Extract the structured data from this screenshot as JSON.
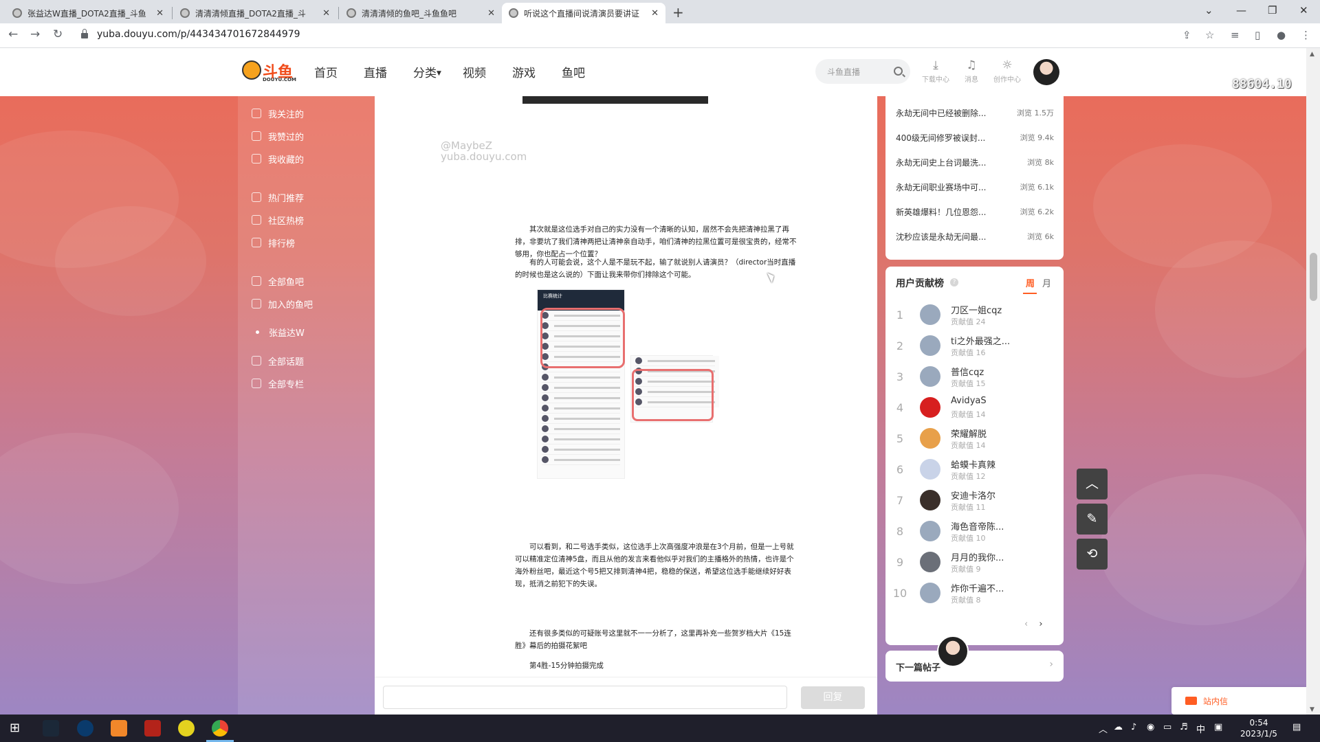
{
  "browser": {
    "tabs": [
      {
        "label": "张益达W直播_DOTA2直播_斗鱼",
        "active": false
      },
      {
        "label": "清清清倾直播_DOTA2直播_斗",
        "active": false
      },
      {
        "label": "清清清倾的鱼吧_斗鱼鱼吧",
        "active": false
      },
      {
        "label": "听说这个直播间说清演员要讲证",
        "active": true
      }
    ],
    "url": "yuba.douyu.com/p/443434701672844979"
  },
  "site": {
    "logo_text": "斗鱼",
    "logo_sub": "DOUYU.COM",
    "nav": [
      "首页",
      "直播",
      "分类",
      "视频",
      "游戏",
      "鱼吧"
    ],
    "search_placeholder": "斗鱼直播",
    "header_icons": [
      {
        "icon": "download-icon",
        "label": "下载中心"
      },
      {
        "icon": "bell-icon",
        "label": "消息"
      },
      {
        "icon": "bulb-icon",
        "label": "创作中心"
      }
    ],
    "overlay_number": "88604.10"
  },
  "sidebar": {
    "items": [
      {
        "label": "我关注的",
        "icon": "heart-outline-icon"
      },
      {
        "label": "我赞过的",
        "icon": "thumbs-up-icon"
      },
      {
        "label": "我收藏的",
        "icon": "star-icon"
      },
      {
        "label": "热门推荐",
        "icon": "fire-icon"
      },
      {
        "label": "社区热榜",
        "icon": "trend-icon"
      },
      {
        "label": "排行榜",
        "icon": "trophy-icon"
      },
      {
        "label": "全部鱼吧",
        "icon": "home-icon"
      },
      {
        "label": "加入的鱼吧",
        "icon": "joined-icon"
      },
      {
        "label": "张益达W",
        "icon": "dot-icon"
      },
      {
        "label": "全部话题",
        "icon": "hash-icon"
      },
      {
        "label": "全部专栏",
        "icon": "column-icon"
      }
    ]
  },
  "article": {
    "watermark_line1": "@MaybeZ",
    "watermark_line2": "yuba.douyu.com",
    "para1": "其次就是这位选手对自己的实力没有一个清晰的认知，居然不会先把清神拉黑了再排，非要坑了我们清神两把让清神亲自动手，咱们清神的拉黑位置可是很宝贵的，经常不够用，你也配占一个位置？",
    "para2": "有的人可能会说，这个人是不是玩不起，输了就说别人请演员？（director当时直播的时候也是这么说的）下面让我来带你们排除这个可能。",
    "para3": "可以看到，和二号选手类似，这位选手上次高强度冲浪是在3个月前，但是一上号就可以精准定位清神5盘，而且从他的发言来看他似乎对我们的主播格外的热情，也许是个海外粉丝吧，最近这个号5把又排到清神4把，稳稳的保送，希望这位选手能继续好好表现，抵消之前犯下的失误。",
    "para4": "还有很多类似的可疑账号这里就不一一分析了，这里再补充一些贺岁档大片《15连胜》幕后的拍摄花絮吧",
    "para5": "第4胜-15分钟拍摄完成",
    "img1_header": "比赛统计"
  },
  "reply": {
    "button_label": "回复"
  },
  "hot_posts": [
    {
      "title": "永劫无间中已经被删除...",
      "views": "浏览 1.5万"
    },
    {
      "title": "400级无间修罗被误封...",
      "views": "浏览 9.4k"
    },
    {
      "title": "永劫无间史上台词最洗...",
      "views": "浏览 8k"
    },
    {
      "title": "永劫无间职业赛场中可...",
      "views": "浏览 6.1k"
    },
    {
      "title": "新英雄爆料！几位恩怨...",
      "views": "浏览 6.2k"
    },
    {
      "title": "沈秒应该是永劫无间最...",
      "views": "浏览 6k"
    }
  ],
  "contrib": {
    "title": "用户贡献榜",
    "help": "?",
    "tab_week": "周",
    "tab_month": "月",
    "rows": [
      {
        "rank": "1",
        "name": "刀区一姐cqz",
        "score": "贡献值 24",
        "color": "#9aa9bd"
      },
      {
        "rank": "2",
        "name": "ti之外最强之...",
        "score": "贡献值 16",
        "color": "#9aa9bd"
      },
      {
        "rank": "3",
        "name": "普信cqz",
        "score": "贡献值 15",
        "color": "#9aa9bd"
      },
      {
        "rank": "4",
        "name": "AvidyaS",
        "score": "贡献值 14",
        "color": "#d71f1f"
      },
      {
        "rank": "5",
        "name": "荣耀解脱",
        "score": "贡献值 14",
        "color": "#e8a04a"
      },
      {
        "rank": "6",
        "name": "蛤蟆卡真辣",
        "score": "贡献值 12",
        "color": "#c9d3e8"
      },
      {
        "rank": "7",
        "name": "安迪卡洛尔",
        "score": "贡献值 11",
        "color": "#3a2f2a"
      },
      {
        "rank": "8",
        "name": "海色音帝陈...",
        "score": "贡献值 10",
        "color": "#9aa9bd"
      },
      {
        "rank": "9",
        "name": "月月的我你...",
        "score": "贡献值 9",
        "color": "#6b6f78"
      },
      {
        "rank": "10",
        "name": "炸你千遍不...",
        "score": "贡献值 8",
        "color": "#9aa9bd"
      }
    ],
    "prev": "‹",
    "next": "›"
  },
  "next_post": {
    "label": "下一篇帖子",
    "arrow": "›"
  },
  "site_message": {
    "label": "站内信"
  },
  "floating": {
    "up": "︿",
    "edit": "✎",
    "share": "⟲"
  },
  "taskbar": {
    "time": "0:54",
    "date": "2023/1/5",
    "ime": "中"
  }
}
